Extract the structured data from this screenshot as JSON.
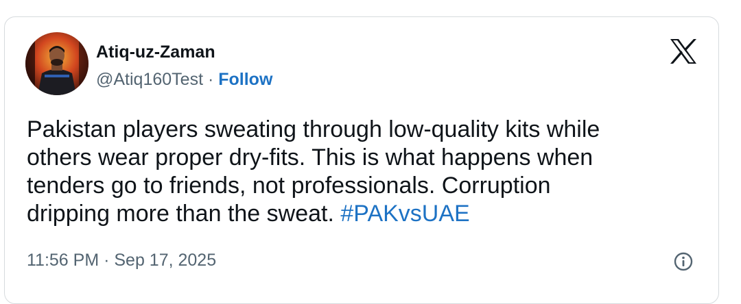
{
  "tweet": {
    "author_name": "Atiq-uz-Zaman",
    "handle": "@Atiq160Test",
    "separator": " · ",
    "follow_label": "Follow",
    "text_body": "Pakistan players sweating through low-quality kits while\nothers wear proper dry-fits. This is what happens when\ntenders go to friends, not professionals. Corruption\ndripping more than the sweat. ",
    "hashtag": "#PAKvsUAE",
    "timestamp": "11:56 PM · Sep 17, 2025"
  },
  "icons": {
    "logo": "x-logo-icon",
    "info": "info-icon",
    "avatar": "profile-photo"
  },
  "colors": {
    "link": "#1d72c4",
    "text": "#0f1419",
    "muted": "#536471",
    "border": "#d6dadd"
  }
}
